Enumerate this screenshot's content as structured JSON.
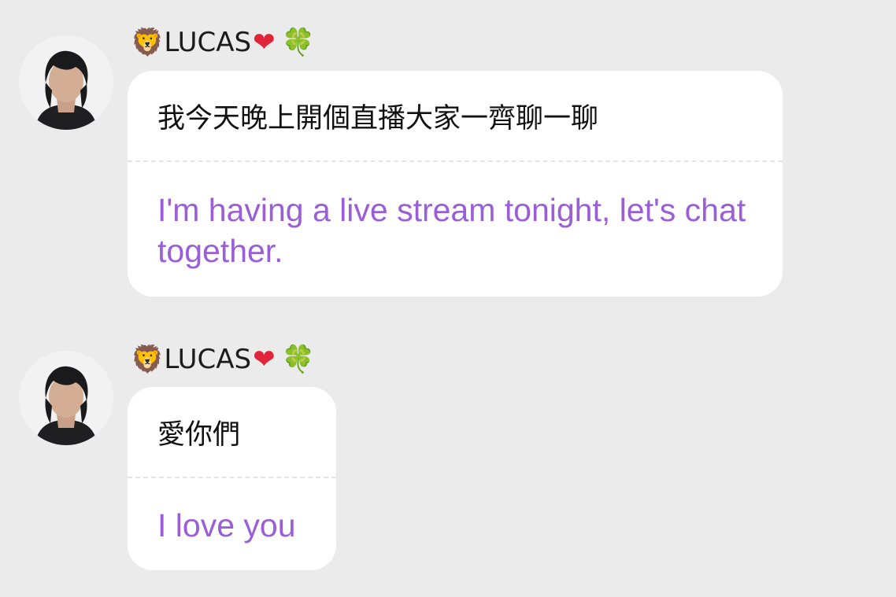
{
  "messages": [
    {
      "sender": {
        "prefix_emoji": "🦁",
        "name": "LUCAS",
        "heart_emoji": "❤",
        "clover_emoji": "🍀"
      },
      "original_text": "我今天晚上開個直播大家一齊聊一聊",
      "translation": "I'm having a live stream tonight, let's chat together."
    },
    {
      "sender": {
        "prefix_emoji": "🦁",
        "name": "LUCAS",
        "heart_emoji": "❤",
        "clover_emoji": "🍀"
      },
      "original_text": "愛你們",
      "translation": "I love you"
    }
  ],
  "colors": {
    "background": "#ebebeb",
    "bubble": "#ffffff",
    "translation_text": "#9a5ed6",
    "original_text": "#111111"
  }
}
